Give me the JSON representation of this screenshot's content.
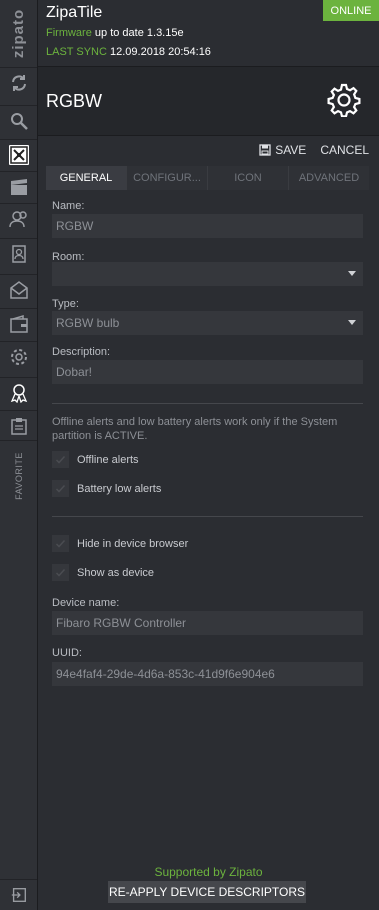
{
  "sidebar": {
    "logo": "zipato",
    "favorite_label": "FAVORITE",
    "items": [
      {
        "icon": "sync-icon"
      },
      {
        "icon": "search-icon"
      },
      {
        "icon": "device-manager-icon"
      },
      {
        "icon": "scenes-icon"
      },
      {
        "icon": "users-icon"
      },
      {
        "icon": "contacts-icon"
      },
      {
        "icon": "messages-icon"
      },
      {
        "icon": "wallet-icon"
      },
      {
        "icon": "settings-icon"
      },
      {
        "icon": "badge-icon"
      },
      {
        "icon": "clipboard-icon"
      }
    ]
  },
  "header": {
    "title": "ZipaTile",
    "status": "ONLINE",
    "firmware_label": "Firmware",
    "firmware_value": "up to date 1.3.15e",
    "last_sync_label": "LAST SYNC",
    "last_sync_value": "12.09.2018 20:54:16"
  },
  "device": {
    "title": "RGBW"
  },
  "toolbar": {
    "save_label": "SAVE",
    "cancel_label": "CANCEL"
  },
  "tabs": [
    {
      "label": "GENERAL",
      "active": true
    },
    {
      "label": "CONFIGUR...",
      "active": false
    },
    {
      "label": "ICON",
      "active": false
    },
    {
      "label": "ADVANCED",
      "active": false
    }
  ],
  "form": {
    "name_label": "Name:",
    "name_value": "RGBW",
    "room_label": "Room:",
    "room_value": "",
    "type_label": "Type:",
    "type_value": "RGBW bulb",
    "description_label": "Description:",
    "description_value": "Dobar!",
    "note": "Offline alerts and low battery alerts work only if the System partition is ACTIVE.",
    "offline_alerts_label": "Offline alerts",
    "battery_low_label": "Battery low alerts",
    "hide_browser_label": "Hide in device browser",
    "show_device_label": "Show as device",
    "device_name_label": "Device name:",
    "device_name_value": "Fibaro RGBW Controller",
    "uuid_label": "UUID:",
    "uuid_value": "94e4faf4-29de-4d6a-853c-41d9f6e904e6"
  },
  "footer": {
    "supported": "Supported by Zipato",
    "reapply_label": "RE-APPLY DEVICE DESCRIPTORS"
  },
  "colors": {
    "accent_green": "#6cb33e",
    "background": "#2b2d32"
  }
}
